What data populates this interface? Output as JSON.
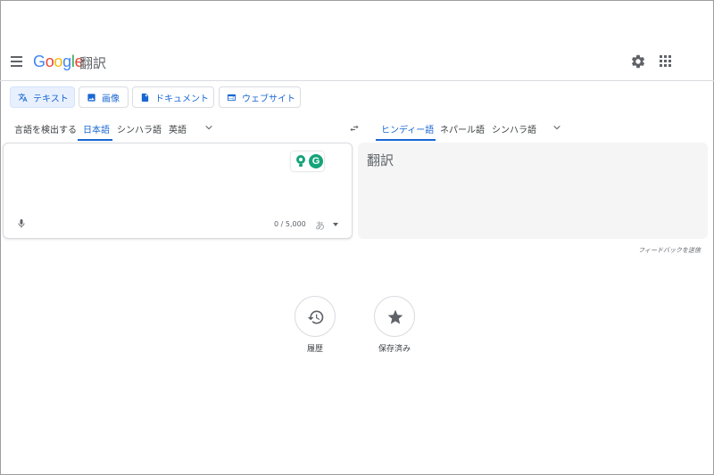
{
  "header": {
    "logo_letters": [
      {
        "ch": "G",
        "color": "#4285f4"
      },
      {
        "ch": "o",
        "color": "#ea4335"
      },
      {
        "ch": "o",
        "color": "#fbbc05"
      },
      {
        "ch": "g",
        "color": "#4285f4"
      },
      {
        "ch": "l",
        "color": "#34a853"
      },
      {
        "ch": "e",
        "color": "#ea4335"
      }
    ],
    "product": "翻訳",
    "icons": [
      "menu-icon",
      "gear-icon",
      "apps-icon"
    ]
  },
  "modes": [
    {
      "label": "テキスト",
      "icon": "translate-icon",
      "active": true
    },
    {
      "label": "画像",
      "icon": "image-icon",
      "active": false
    },
    {
      "label": "ドキュメント",
      "icon": "document-icon",
      "active": false
    },
    {
      "label": "ウェブサイト",
      "icon": "website-icon",
      "active": false
    }
  ],
  "source_langs": {
    "items": [
      "言語を検出する",
      "日本語",
      "シンハラ語",
      "英語"
    ],
    "selected": "日本語"
  },
  "target_langs": {
    "items": [
      "ヒンディー語",
      "ネパール語",
      "シンハラ語"
    ],
    "selected": "ヒンディー語"
  },
  "source": {
    "value": "",
    "char_count": "0 / 5,000",
    "ime_label": "あ"
  },
  "target": {
    "placeholder": "翻訳"
  },
  "extension": {
    "letter": "G",
    "color": "#15a47a"
  },
  "feedback": "フィードバックを送信",
  "actions": {
    "history": "履歴",
    "saved": "保存済み"
  },
  "colors": {
    "accent": "#1967d2",
    "active_bg": "#e8f0fe",
    "icon": "#5f6368"
  }
}
